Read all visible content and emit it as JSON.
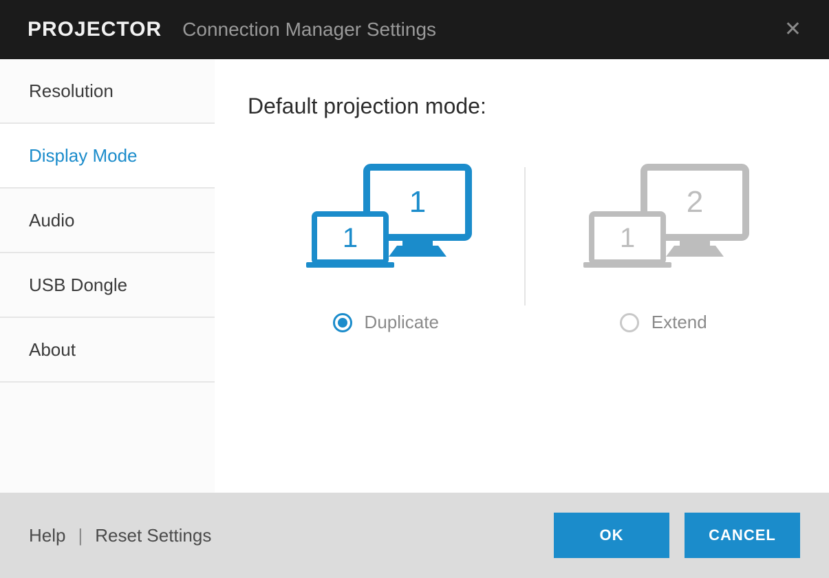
{
  "header": {
    "app_name": "PROJECTOR",
    "subtitle": "Connection Manager Settings"
  },
  "sidebar": {
    "items": [
      {
        "label": "Resolution",
        "active": false
      },
      {
        "label": "Display Mode",
        "active": true
      },
      {
        "label": "Audio",
        "active": false
      },
      {
        "label": "USB Dongle",
        "active": false
      },
      {
        "label": "About",
        "active": false
      }
    ]
  },
  "main": {
    "heading": "Default projection mode:",
    "options": [
      {
        "label": "Duplicate",
        "selected": true,
        "laptop_num": "1",
        "monitor_num": "1"
      },
      {
        "label": "Extend",
        "selected": false,
        "laptop_num": "1",
        "monitor_num": "2"
      }
    ]
  },
  "footer": {
    "help": "Help",
    "reset": "Reset Settings",
    "ok": "OK",
    "cancel": "CANCEL"
  },
  "colors": {
    "accent": "#1b8ccb",
    "muted": "#b7b7b7"
  }
}
